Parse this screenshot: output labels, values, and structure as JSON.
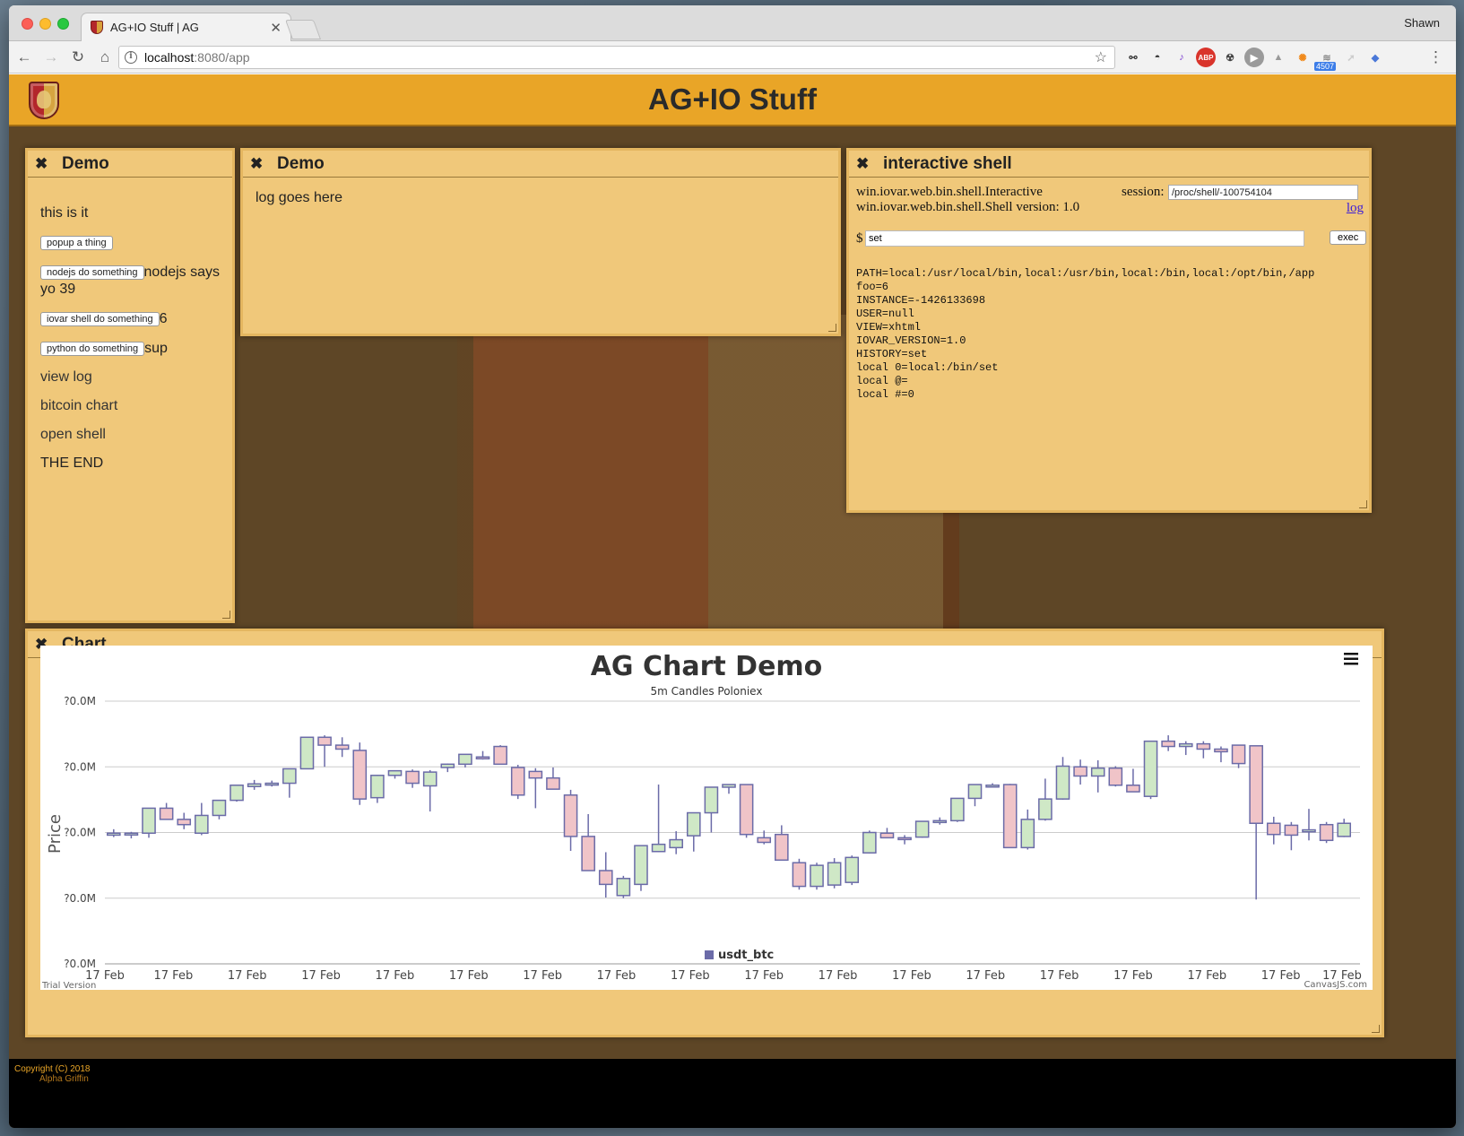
{
  "browser": {
    "tab_title": "AG+IO Stuff | AG",
    "profile_name": "Shawn",
    "url_host": "localhost",
    "url_rest": ":8080/app",
    "extension_badge": "4507"
  },
  "header": {
    "title": "AG+IO Stuff"
  },
  "demo_panel": {
    "title": "Demo",
    "intro": "this is it",
    "popup_btn": "popup a thing",
    "nodejs_btn": "nodejs do something",
    "nodejs_result": "nodejs says",
    "nodejs_result2": "yo 39",
    "iovar_btn": "iovar shell do something",
    "iovar_result": "6",
    "python_btn": "python do something",
    "python_result": "sup",
    "nav": [
      "view log",
      "bitcoin chart",
      "open shell"
    ],
    "end": "THE END"
  },
  "log_panel": {
    "title": "Demo",
    "text": "log goes here"
  },
  "shell_panel": {
    "title": "interactive shell",
    "line1": "win.iovar.web.bin.shell.Interactive",
    "line2": "win.iovar.web.bin.shell.Shell version: 1.0",
    "session_label": "session:",
    "session_value": "/proc/shell/-100754104",
    "log_link": "log",
    "prompt": "$",
    "command": "set",
    "exec_label": "exec",
    "output": [
      "PATH=local:/usr/local/bin,local:/usr/bin,local:/bin,local:/opt/bin,/app",
      "foo=6",
      "INSTANCE=-1426133698",
      "USER=null",
      "VIEW=xhtml",
      "IOVAR_VERSION=1.0",
      "HISTORY=set",
      "local 0=local:/bin/set",
      "local @=",
      "local #=0"
    ]
  },
  "chart_panel": {
    "title": "Chart"
  },
  "chart_data": {
    "type": "candlestick",
    "title": "AG Chart Demo",
    "subtitle": "5m Candles Poloniex",
    "ylabel": "Price",
    "y_ticks": [
      "?0.0M",
      "?0.0M",
      "?0.0M",
      "?0.0M",
      "?0.0M"
    ],
    "x_tick_labels": [
      "17 Feb",
      "17 Feb",
      "17 Feb",
      "17 Feb",
      "17 Feb",
      "17 Feb",
      "17 Feb",
      "17 Feb",
      "17 Feb",
      "17 Feb",
      "17 Feb",
      "17 Feb",
      "17 Feb",
      "17 Feb",
      "17 Feb",
      "17 Feb",
      "17 Feb",
      "17 Feb"
    ],
    "legend": "usdt_btc",
    "watermark_left": "Trial Version",
    "watermark_right": "CanvasJS.com",
    "ylim": [
      0,
      4
    ],
    "up_color": "#cfe8c6",
    "down_color": "#f0c4c8",
    "outline_color": "#6b6ba8",
    "candles": [
      [
        1.96,
        2.05,
        1.93,
        1.99
      ],
      [
        1.98,
        2.01,
        1.91,
        1.99
      ],
      [
        1.99,
        2.05,
        1.92,
        2.37
      ],
      [
        2.37,
        2.45,
        2.25,
        2.2
      ],
      [
        2.2,
        2.3,
        2.05,
        2.12
      ],
      [
        1.99,
        2.45,
        1.96,
        2.26
      ],
      [
        2.26,
        2.48,
        2.2,
        2.49
      ],
      [
        2.49,
        2.72,
        2.47,
        2.72
      ],
      [
        2.7,
        2.8,
        2.65,
        2.74
      ],
      [
        2.74,
        2.79,
        2.7,
        2.75
      ],
      [
        2.75,
        2.88,
        2.53,
        2.97
      ],
      [
        2.97,
        3.44,
        2.97,
        3.45
      ],
      [
        3.45,
        3.48,
        3.0,
        3.33
      ],
      [
        3.33,
        3.45,
        3.15,
        3.27
      ],
      [
        3.25,
        3.37,
        2.42,
        2.51
      ],
      [
        2.53,
        2.88,
        2.45,
        2.87
      ],
      [
        2.87,
        2.92,
        2.82,
        2.94
      ],
      [
        2.93,
        2.96,
        2.68,
        2.75
      ],
      [
        2.71,
        2.95,
        2.32,
        2.92
      ],
      [
        2.99,
        3.05,
        2.92,
        3.04
      ],
      [
        3.04,
        3.18,
        2.99,
        3.19
      ],
      [
        3.15,
        3.24,
        3.11,
        3.14
      ],
      [
        3.31,
        3.33,
        3.09,
        3.04
      ],
      [
        2.99,
        3.03,
        2.51,
        2.57
      ],
      [
        2.93,
        2.98,
        2.37,
        2.83
      ],
      [
        2.83,
        2.99,
        2.7,
        2.66
      ],
      [
        2.57,
        2.65,
        1.72,
        1.94
      ],
      [
        1.94,
        2.28,
        1.45,
        1.42
      ],
      [
        1.42,
        1.7,
        1.01,
        1.21
      ],
      [
        1.04,
        1.34,
        1.0,
        1.3
      ],
      [
        1.21,
        1.8,
        1.11,
        1.8
      ],
      [
        1.71,
        2.73,
        1.7,
        1.82
      ],
      [
        1.77,
        2.02,
        1.67,
        1.89
      ],
      [
        1.95,
        2.19,
        1.71,
        2.3
      ],
      [
        2.3,
        2.35,
        2.0,
        2.69
      ],
      [
        2.69,
        2.67,
        2.59,
        2.73
      ],
      [
        2.73,
        2.73,
        1.92,
        1.97
      ],
      [
        1.92,
        2.03,
        1.82,
        1.85
      ],
      [
        1.97,
        2.11,
        1.57,
        1.58
      ],
      [
        1.54,
        1.6,
        1.13,
        1.18
      ],
      [
        1.18,
        1.54,
        1.13,
        1.5
      ],
      [
        1.2,
        1.61,
        1.15,
        1.54
      ],
      [
        1.24,
        1.65,
        1.2,
        1.62
      ],
      [
        1.69,
        2.03,
        1.68,
        2.0
      ],
      [
        1.99,
        2.07,
        1.94,
        1.92
      ],
      [
        1.92,
        1.96,
        1.82,
        1.9
      ],
      [
        1.93,
        2.12,
        1.92,
        2.17
      ],
      [
        2.17,
        2.23,
        2.12,
        2.18
      ],
      [
        2.18,
        2.52,
        2.16,
        2.52
      ],
      [
        2.52,
        2.72,
        2.4,
        2.73
      ],
      [
        2.72,
        2.75,
        2.7,
        2.72
      ],
      [
        2.73,
        2.74,
        1.82,
        1.77
      ],
      [
        1.77,
        2.35,
        1.74,
        2.2
      ],
      [
        2.2,
        2.82,
        2.18,
        2.51
      ],
      [
        2.51,
        3.15,
        2.5,
        3.01
      ],
      [
        3.0,
        3.11,
        2.73,
        2.86
      ],
      [
        2.86,
        3.1,
        2.61,
        2.98
      ],
      [
        2.98,
        3.01,
        2.7,
        2.72
      ],
      [
        2.72,
        2.97,
        2.7,
        2.62
      ],
      [
        2.55,
        2.89,
        2.51,
        3.39
      ],
      [
        3.39,
        3.48,
        3.24,
        3.31
      ],
      [
        3.31,
        3.39,
        3.18,
        3.35
      ],
      [
        3.35,
        3.39,
        3.13,
        3.27
      ],
      [
        3.27,
        3.31,
        3.07,
        3.23
      ],
      [
        3.33,
        3.28,
        2.98,
        3.05
      ],
      [
        3.32,
        3.31,
        0.98,
        2.14
      ],
      [
        2.14,
        2.24,
        1.82,
        1.97
      ],
      [
        2.11,
        2.16,
        1.73,
        1.96
      ],
      [
        2.01,
        2.36,
        1.88,
        2.04
      ],
      [
        2.12,
        2.16,
        1.84,
        1.88
      ],
      [
        1.94,
        2.21,
        1.93,
        2.14
      ]
    ]
  }
}
